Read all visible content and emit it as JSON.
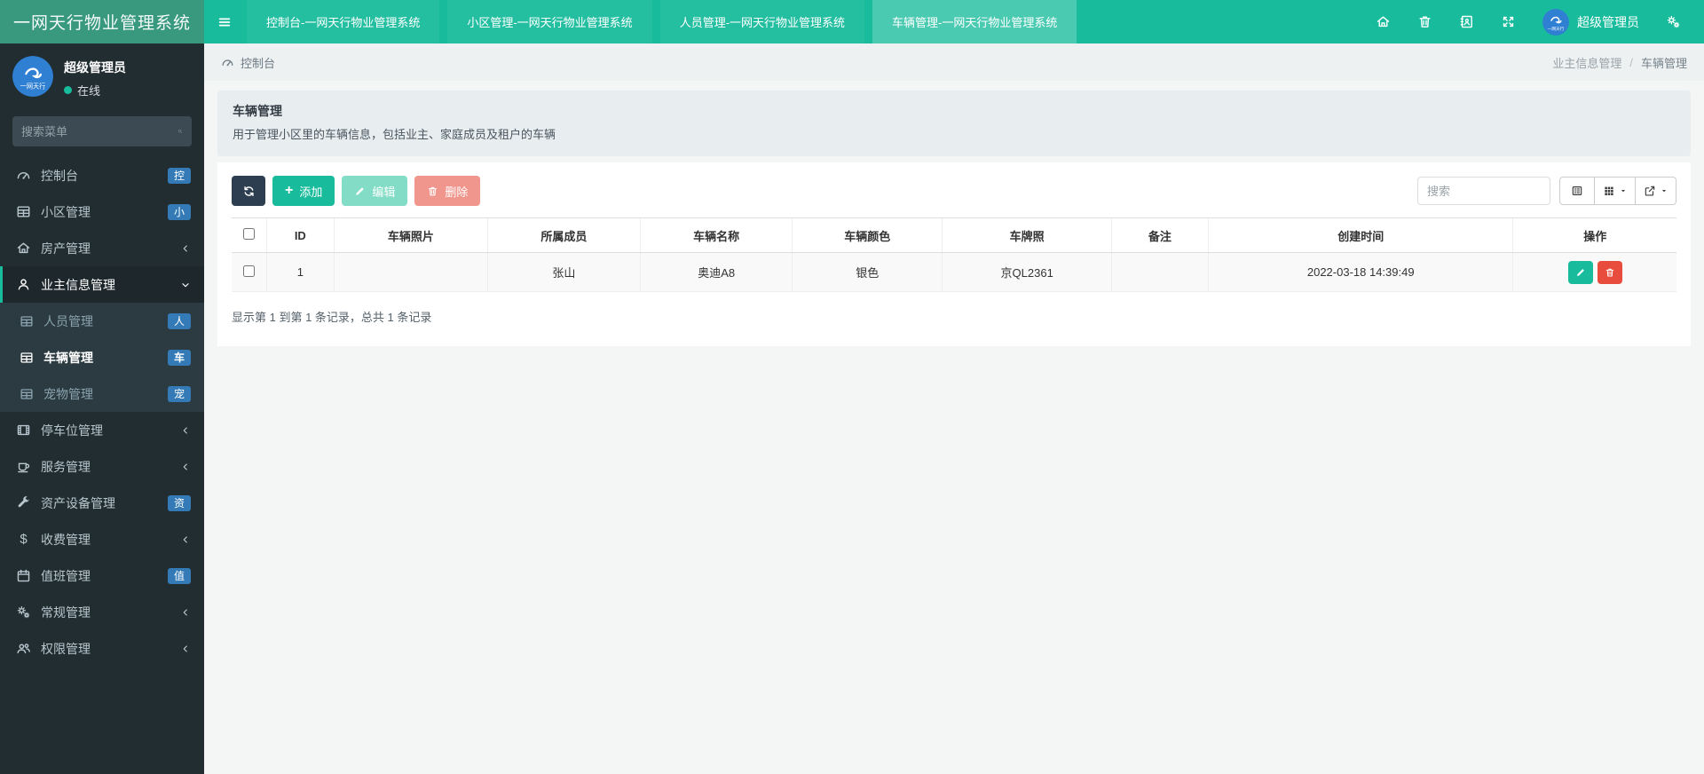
{
  "app": {
    "brand": "一网天行物业管理系统"
  },
  "navbar": {
    "tabs": [
      {
        "label": "控制台-一网天行物业管理系统",
        "active": false
      },
      {
        "label": "小区管理-一网天行物业管理系统",
        "active": false
      },
      {
        "label": "人员管理-一网天行物业管理系统",
        "active": false
      },
      {
        "label": "车辆管理-一网天行物业管理系统",
        "active": true
      }
    ],
    "icons": [
      "home-icon",
      "trash-icon",
      "address-book-icon",
      "expand-icon",
      "gears-icon"
    ],
    "user_name": "超级管理员",
    "avatar_text": "一网天行"
  },
  "sidebar": {
    "user": {
      "name": "超级管理员",
      "status": "在线"
    },
    "search_placeholder": "搜索菜单",
    "items": [
      {
        "label": "控制台",
        "icon": "dashboard",
        "badge": "控"
      },
      {
        "label": "小区管理",
        "icon": "table",
        "badge": "小"
      },
      {
        "label": "房产管理",
        "icon": "home",
        "chevron": "left"
      },
      {
        "label": "业主信息管理",
        "icon": "user",
        "chevron": "down",
        "active": true
      },
      {
        "label": "停车位管理",
        "icon": "film",
        "chevron": "left"
      },
      {
        "label": "服务管理",
        "icon": "cup",
        "chevron": "left"
      },
      {
        "label": "资产设备管理",
        "icon": "wrench",
        "badge": "资"
      },
      {
        "label": "收费管理",
        "icon": "dollar",
        "chevron": "left"
      },
      {
        "label": "值班管理",
        "icon": "calendar",
        "badge": "值"
      },
      {
        "label": "常规管理",
        "icon": "gears",
        "chevron": "left"
      },
      {
        "label": "权限管理",
        "icon": "users",
        "chevron": "left"
      }
    ],
    "submenu": [
      {
        "label": "人员管理",
        "badge": "人",
        "active": false
      },
      {
        "label": "车辆管理",
        "badge": "车",
        "active": true
      },
      {
        "label": "宠物管理",
        "badge": "宠",
        "active": false
      }
    ]
  },
  "breadcrumb": {
    "home": "控制台",
    "section": "业主信息管理",
    "separator": "/",
    "current": "车辆管理"
  },
  "page_header": {
    "title": "车辆管理",
    "description": "用于管理小区里的车辆信息，包括业主、家庭成员及租户的车辆"
  },
  "toolbar": {
    "add_label": "添加",
    "edit_label": "编辑",
    "delete_label": "删除",
    "search_placeholder": "搜索"
  },
  "table": {
    "columns": {
      "id": "ID",
      "photo": "车辆照片",
      "member": "所属成员",
      "name": "车辆名称",
      "color": "车辆颜色",
      "plate": "车牌照",
      "remark": "备注",
      "created": "创建时间",
      "ops": "操作"
    },
    "rows": [
      {
        "id": "1",
        "photo": "",
        "member": "张山",
        "name": "奥迪A8",
        "color": "银色",
        "plate": "京QL2361",
        "remark": "",
        "created": "2022-03-18 14:39:49"
      }
    ]
  },
  "summary_text": "显示第 1 到第 1 条记录，总共 1 条记录",
  "colors": {
    "navbar": "#18bc9c",
    "navbar_brand": "#38997f",
    "tab_active": "#2fc8a8",
    "sidebar": "#222d32",
    "submenu_bg": "#2c3b41",
    "accent": "#18bc9c",
    "badge": "#337ab7",
    "danger": "#e74c3c",
    "dark_button": "#2c3e50",
    "online_dot": "#18bc9c",
    "avatar_bg": "#2f7fd2"
  }
}
